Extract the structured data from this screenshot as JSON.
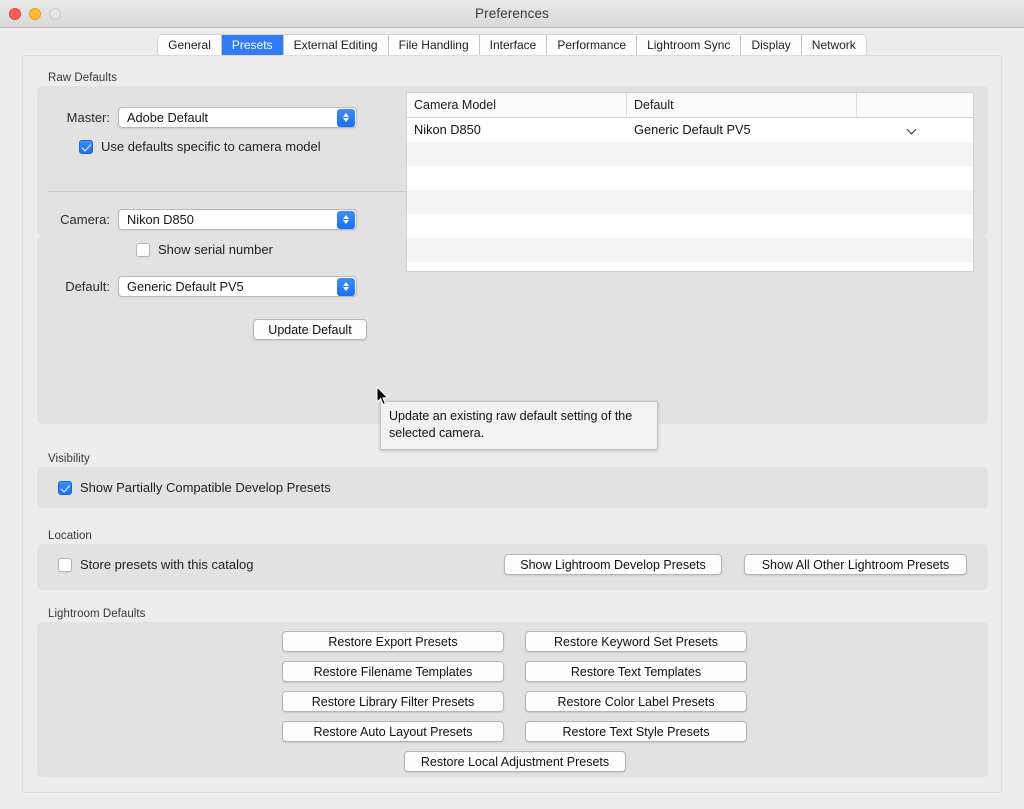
{
  "window": {
    "title": "Preferences",
    "traffic_lights": [
      "close-button",
      "minimize-button",
      "zoom-button"
    ]
  },
  "tabs": [
    {
      "label": "General",
      "active": false
    },
    {
      "label": "Presets",
      "active": true
    },
    {
      "label": "External Editing",
      "active": false
    },
    {
      "label": "File Handling",
      "active": false
    },
    {
      "label": "Interface",
      "active": false
    },
    {
      "label": "Performance",
      "active": false
    },
    {
      "label": "Lightroom Sync",
      "active": false
    },
    {
      "label": "Display",
      "active": false
    },
    {
      "label": "Network",
      "active": false
    }
  ],
  "raw_defaults": {
    "group_label": "Raw Defaults",
    "master_label": "Master:",
    "master_value": "Adobe Default",
    "use_camera_defaults_label": "Use defaults specific to camera model",
    "use_camera_defaults_checked": true,
    "camera_label": "Camera:",
    "camera_value": "Nikon D850",
    "show_serial_label": "Show serial number",
    "show_serial_checked": false,
    "default_label": "Default:",
    "default_value": "Generic Default PV5",
    "update_default_button": "Update Default",
    "table": {
      "columns": [
        "Camera Model",
        "Default",
        ""
      ],
      "rows": [
        {
          "camera_model": "Nikon D850",
          "default": "Generic Default PV5"
        }
      ],
      "empty_row_count": 6
    },
    "tooltip": "Update an existing raw default setting of the selected camera."
  },
  "visibility": {
    "group_label": "Visibility",
    "show_partially_compatible_label": "Show Partially Compatible Develop Presets",
    "show_partially_compatible_checked": true
  },
  "location": {
    "group_label": "Location",
    "store_presets_label": "Store presets with this catalog",
    "store_presets_checked": false,
    "show_develop_presets_button": "Show Lightroom Develop Presets",
    "show_other_presets_button": "Show All Other Lightroom Presets"
  },
  "lightroom_defaults": {
    "group_label": "Lightroom Defaults",
    "left_buttons": [
      "Restore Export Presets",
      "Restore Filename Templates",
      "Restore Library Filter Presets",
      "Restore Auto Layout Presets"
    ],
    "right_buttons": [
      "Restore Keyword Set Presets",
      "Restore Text Templates",
      "Restore Color Label Presets",
      "Restore Text Style Presets"
    ],
    "bottom_button": "Restore Local Adjustment Presets"
  },
  "colors": {
    "accent": "#2f7cf6",
    "window_bg": "#ececec",
    "panel_bg": "#e2e2e2",
    "close": "#ff5f57",
    "minimize": "#ffbd2e"
  }
}
